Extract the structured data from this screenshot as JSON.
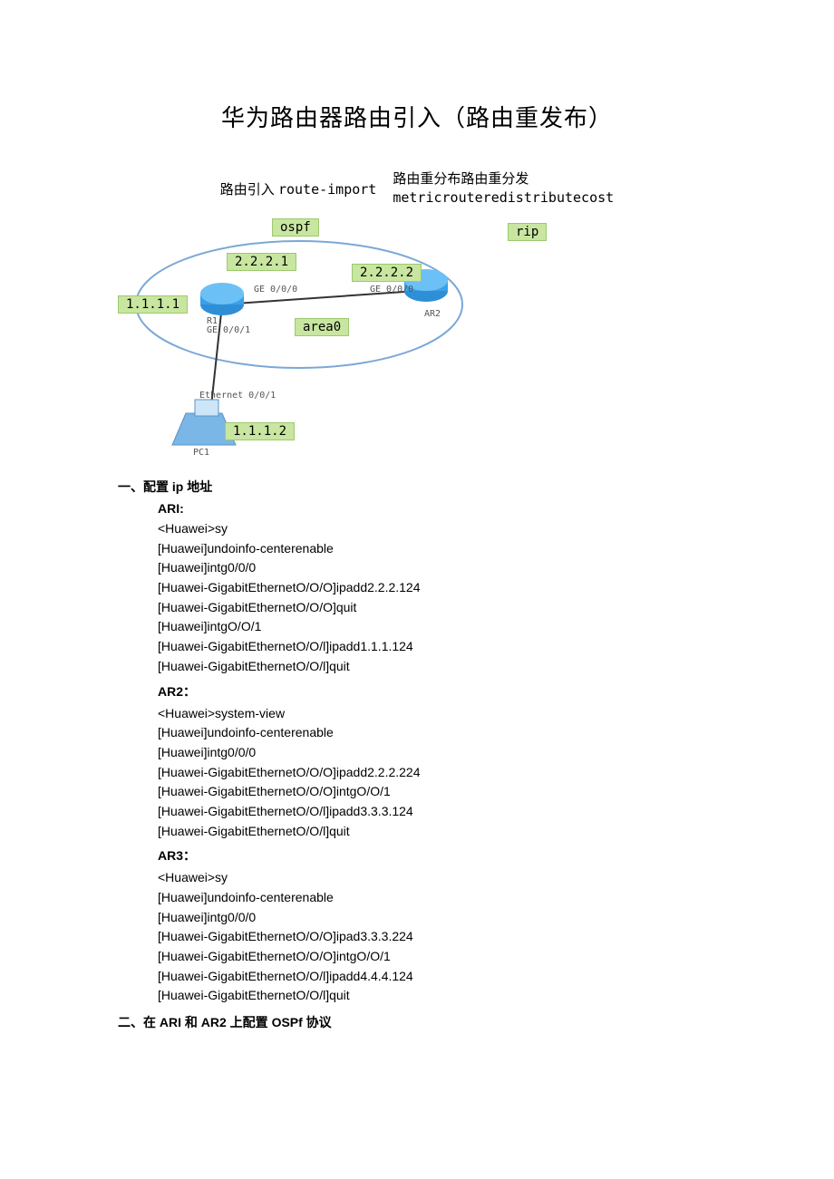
{
  "title": "华为路由器路由引入（路由重发布）",
  "route_import": {
    "left_cn": "路由引入 ",
    "left_mono": "route-import",
    "right_line1": "路由重分布路由重分发",
    "right_line2": "metricrouteredistributecost"
  },
  "diagram": {
    "ospf": "ospf",
    "rip": "rip",
    "area0": "area0",
    "ip_1_1_1_1": "1.1.1.1",
    "ip_1_1_1_2": "1.1.1.2",
    "ip_2_2_2_1": "2.2.2.1",
    "ip_2_2_2_2": "2.2.2.2",
    "ge000_a": "GE 0/0/0",
    "ge000_b": "GE 0/0/0",
    "r1": "R1",
    "ge001": "GE 0/0/1",
    "ar2": "AR2",
    "eth001": "Ethernet 0/0/1",
    "pc1": "PC1"
  },
  "sections": {
    "s1_title": "一、配置 ip 地址",
    "s2_title": "二、在 ARI 和 AR2 上配置 OSPf 协议",
    "ar1": {
      "heading": "ARI:",
      "lines": [
        "<Huawei>sy",
        "[Huawei]undoinfo-centerenable",
        "[Huawei]intg0/0/0",
        "[Huawei-GigabitEthernetO/O/O]ipadd2.2.2.124",
        "[Huawei-GigabitEthernetO/O/O]quit",
        "[Huawei]intgO/O/1",
        "[Huawei-GigabitEthernetO/O/l]ipadd1.1.1.124",
        "[Huawei-GigabitEthernetO/O/l]quit"
      ]
    },
    "ar2": {
      "heading": "AR2：",
      "lines": [
        "<Huawei>system-view",
        "[Huawei]undoinfo-centerenable",
        "[Huawei]intg0/0/0",
        "[Huawei-GigabitEthernetO/O/O]ipadd2.2.2.224",
        "[Huawei-GigabitEthernetO/O/O]intgO/O/1",
        "[Huawei-GigabitEthernetO/O/l]ipadd3.3.3.124",
        "[Huawei-GigabitEthernetO/O/l]quit"
      ]
    },
    "ar3": {
      "heading": "AR3：",
      "lines": [
        "<Huawei>sy",
        "[Huawei]undoinfo-centerenable",
        "[Huawei]intg0/0/0",
        "[Huawei-GigabitEthernetO/O/O]ipad3.3.3.224",
        "[Huawei-GigabitEthernetO/O/O]intgO/O/1",
        "[Huawei-GigabitEthernetO/O/l]ipadd4.4.4.124",
        "[Huawei-GigabitEthernetO/O/l]quit"
      ]
    }
  }
}
